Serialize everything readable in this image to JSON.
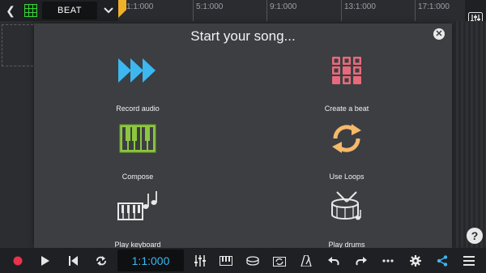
{
  "top": {
    "track_name": "BEAT",
    "ruler_ticks": [
      "1:1:000",
      "5:1:000",
      "9:1:000",
      "13:1:000",
      "17:1:000"
    ]
  },
  "dialog": {
    "title": "Start your song...",
    "options": [
      {
        "label": "Record audio",
        "icon": "fast-forward-arrows-icon"
      },
      {
        "label": "Create a beat",
        "icon": "drum-pads-icon"
      },
      {
        "label": "Compose",
        "icon": "piano-keys-icon"
      },
      {
        "label": "Use Loops",
        "icon": "loop-arrows-icon"
      },
      {
        "label": "Play keyboard",
        "icon": "keyboard-note-icon"
      },
      {
        "label": "Play drums",
        "icon": "drum-icon"
      }
    ]
  },
  "transport": {
    "time": "1:1:000"
  },
  "colors": {
    "accent_blue": "#3db7f0",
    "record_red": "#e8334a",
    "pad_pink": "#e86a7a",
    "piano_green": "#8dc63f",
    "loop_orange": "#f5b96a",
    "marker_yellow": "#f0b12a"
  }
}
